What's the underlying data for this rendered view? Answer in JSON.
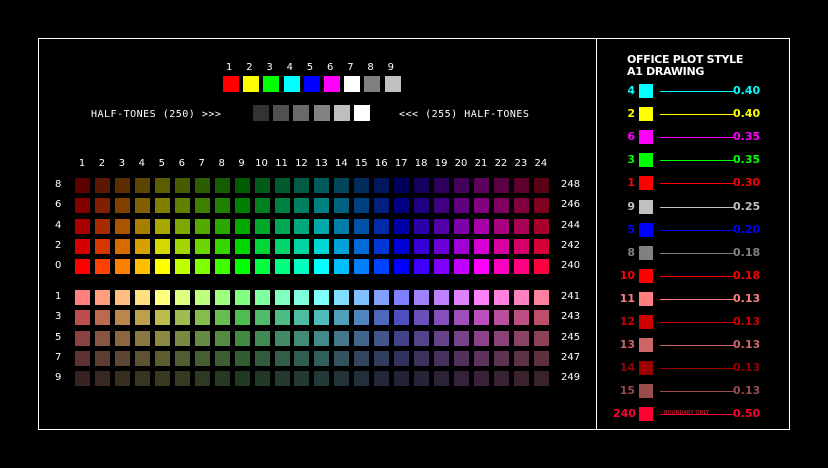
{
  "top_palette": {
    "labels": [
      "1",
      "2",
      "3",
      "4",
      "5",
      "6",
      "7",
      "8",
      "9"
    ],
    "colors": [
      "#ff0000",
      "#ffff00",
      "#00ff00",
      "#00ffff",
      "#0000ff",
      "#ff00ff",
      "#ffffff",
      "#808080",
      "#c0c0c0"
    ]
  },
  "halftones": {
    "left_label": "HALF-TONES (250) >>>",
    "right_label": "<<< (255) HALF-TONES",
    "colors": [
      "#333333",
      "#505050",
      "#696969",
      "#828282",
      "#bebebe",
      "#ffffff"
    ]
  },
  "grid": {
    "column_labels": [
      "1",
      "2",
      "3",
      "4",
      "5",
      "6",
      "7",
      "8",
      "9",
      "10",
      "11",
      "12",
      "13",
      "14",
      "15",
      "16",
      "17",
      "18",
      "19",
      "20",
      "21",
      "22",
      "23",
      "24"
    ],
    "hues": [
      0,
      15,
      30,
      45,
      60,
      75,
      90,
      105,
      120,
      135,
      150,
      165,
      180,
      195,
      210,
      225,
      240,
      255,
      270,
      285,
      300,
      315,
      330,
      345
    ],
    "upper_rows": [
      {
        "left": "8",
        "right": "248",
        "sat": 100,
        "light": 18
      },
      {
        "left": "6",
        "right": "246",
        "sat": 100,
        "light": 25
      },
      {
        "left": "4",
        "right": "244",
        "sat": 100,
        "light": 33
      },
      {
        "left": "2",
        "right": "242",
        "sat": 100,
        "light": 42
      },
      {
        "left": "0",
        "right": "240",
        "sat": 100,
        "light": 50
      }
    ],
    "lower_rows": [
      {
        "left": "1",
        "right": "241",
        "sat": 100,
        "light": 75
      },
      {
        "left": "3",
        "right": "243",
        "sat": 45,
        "light": 52
      },
      {
        "left": "5",
        "right": "245",
        "sat": 35,
        "light": 40
      },
      {
        "left": "7",
        "right": "247",
        "sat": 30,
        "light": 28
      },
      {
        "left": "9",
        "right": "249",
        "sat": 25,
        "light": 18
      }
    ]
  },
  "plot_style": {
    "title_line1": "OFFICE PLOT STYLE",
    "title_line2": "A1 DRAWING",
    "entries": [
      {
        "num": "4",
        "color": "#00ffff",
        "value": "0.40"
      },
      {
        "num": "2",
        "color": "#ffff00",
        "value": "0.40"
      },
      {
        "num": "6",
        "color": "#ff00ff",
        "value": "0.35"
      },
      {
        "num": "3",
        "color": "#00ff00",
        "value": "0.35"
      },
      {
        "num": "1",
        "color": "#ff0000",
        "value": "0.30"
      },
      {
        "num": "9",
        "color": "#c0c0c0",
        "value": "0.25"
      },
      {
        "num": "5",
        "color": "#0000ff",
        "value": "0.20"
      },
      {
        "num": "8",
        "color": "#808080",
        "value": "0.18"
      },
      {
        "num": "10",
        "color": "#ff0000",
        "value": "0.18"
      },
      {
        "num": "11",
        "color": "#ff7f7f",
        "value": "0.13"
      },
      {
        "num": "12",
        "color": "#cc0000",
        "value": "0.13"
      },
      {
        "num": "13",
        "color": "#cc6666",
        "value": "0.13"
      },
      {
        "num": "14",
        "color": "#990000",
        "value": "0.13"
      },
      {
        "num": "15",
        "color": "#994c4c",
        "value": "0.13"
      },
      {
        "num": "240",
        "color": "#ff0033",
        "value": "0.50"
      }
    ],
    "boundary_note": "BOUNDARY ONLY"
  }
}
